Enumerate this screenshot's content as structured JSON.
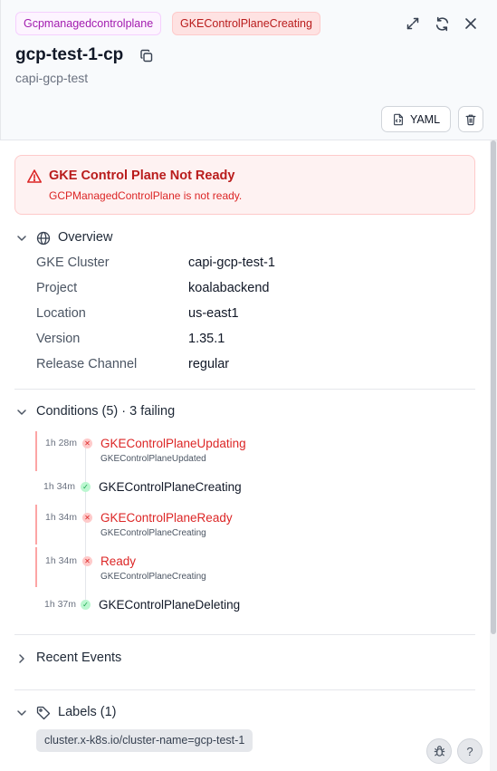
{
  "header": {
    "kind_badge": "Gcpmanagedcontrolplane",
    "status_badge": "GKEControlPlaneCreating",
    "title": "gcp-test-1-cp",
    "subtitle": "capi-gcp-test",
    "yaml_label": "YAML"
  },
  "alert": {
    "title": "GKE Control Plane Not Ready",
    "message": "GCPManagedControlPlane is not ready."
  },
  "overview": {
    "title": "Overview",
    "rows": [
      {
        "key": "GKE Cluster",
        "value": "capi-gcp-test-1"
      },
      {
        "key": "Project",
        "value": "koalabackend"
      },
      {
        "key": "Location",
        "value": "us-east1"
      },
      {
        "key": "Version",
        "value": "1.35.1"
      },
      {
        "key": "Release Channel",
        "value": "regular"
      }
    ]
  },
  "conditions": {
    "title": "Conditions (5) · 3 failing",
    "items": [
      {
        "time": "1h 28m",
        "name": "GKEControlPlaneUpdating",
        "reason": "GKEControlPlaneUpdated",
        "status": "failing"
      },
      {
        "time": "1h 34m",
        "name": "GKEControlPlaneCreating",
        "reason": "",
        "status": "ok"
      },
      {
        "time": "1h 34m",
        "name": "GKEControlPlaneReady",
        "reason": "GKEControlPlaneCreating",
        "status": "failing"
      },
      {
        "time": "1h 34m",
        "name": "Ready",
        "reason": "GKEControlPlaneCreating",
        "status": "failing"
      },
      {
        "time": "1h 37m",
        "name": "GKEControlPlaneDeleting",
        "reason": "",
        "status": "ok"
      }
    ]
  },
  "events": {
    "title": "Recent Events"
  },
  "labels": {
    "title": "Labels (1)",
    "items": [
      "cluster.x-k8s.io/cluster-name=gcp-test-1"
    ]
  },
  "fab": {
    "help_label": "?"
  },
  "colors": {
    "failing": "#dc2626",
    "ok": "#16a34a",
    "kind_badge": "#a21caf",
    "alert_bg": "#fef2f2"
  },
  "icons": {
    "expand": "expand-icon",
    "refresh": "refresh-icon",
    "close": "close-icon",
    "copy": "copy-icon",
    "yaml": "file-code-icon",
    "delete": "trash-icon",
    "alert": "warning-triangle-icon",
    "overview": "globe-icon",
    "labels": "tag-icon",
    "debug": "bug-icon",
    "help": "help-icon"
  }
}
